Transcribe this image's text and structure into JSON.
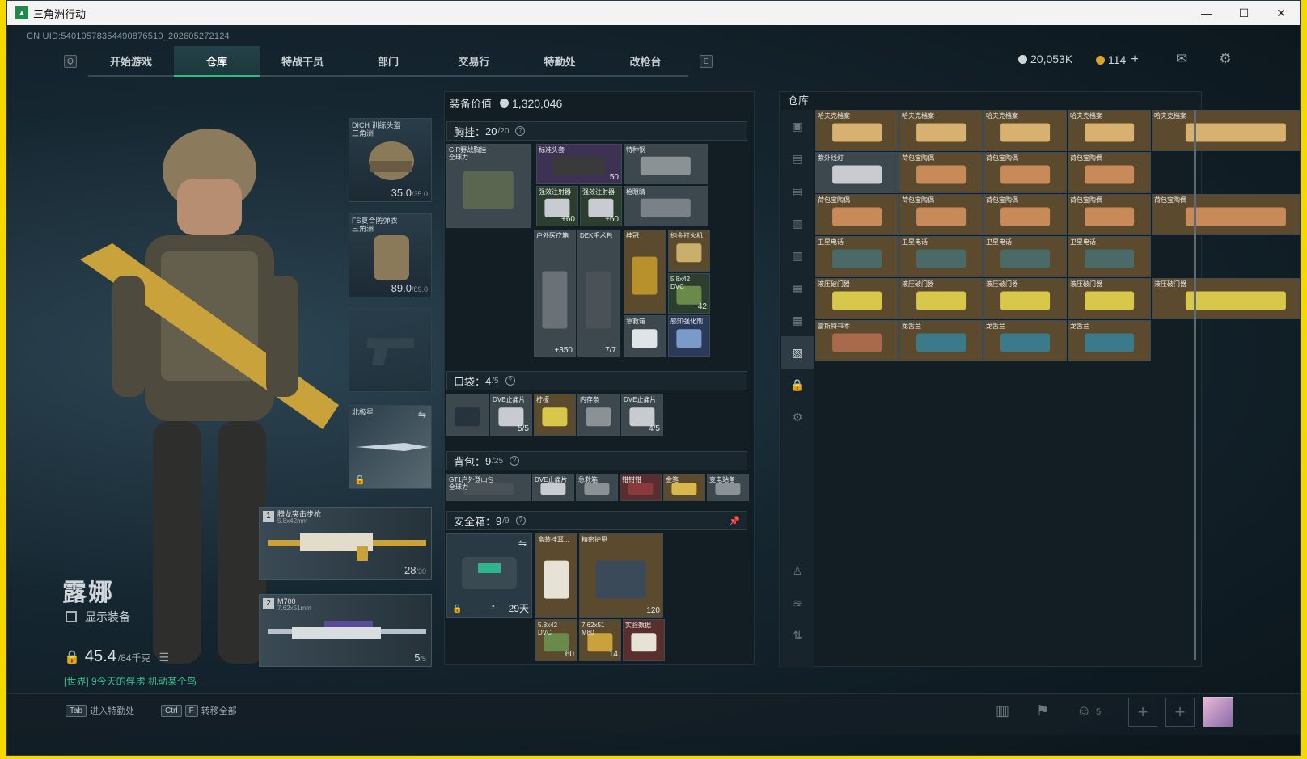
{
  "window": {
    "title": "三角洲行动"
  },
  "header": {
    "uid": "CN UID:5401057835449087651​0_202605272124",
    "tabs_left_key": "Q",
    "tabs_right_key": "E",
    "tabs": [
      "开始游戏",
      "仓库",
      "特战干员",
      "部门",
      "交易行",
      "特勤处",
      "改枪台"
    ],
    "active_tab": "仓库",
    "coins": "20,053K",
    "tokens": "114",
    "token_plus": "+"
  },
  "character": {
    "name": "露娜",
    "show_equipment": "显示装备",
    "weight": "45.4",
    "weight_max": "/84千克",
    "chat": "[世界] 9今天的俘虏 机动某个鸟"
  },
  "equip": {
    "helmet": {
      "label1": "DICH 训练头盔",
      "label2": "三角洲",
      "dur": "35.0",
      "max": "/35.0"
    },
    "armor": {
      "label1": "FS复合防弹衣",
      "label2": "三角洲",
      "dur": "89.0",
      "max": "/89.0"
    },
    "melee": {
      "label": "北极星"
    },
    "weapon1": {
      "num": "1",
      "name": "腾龙突击步枪",
      "sub": "5.8x42mm",
      "ammo": "28",
      "max": "/30"
    },
    "weapon2": {
      "num": "2",
      "name": "M700",
      "sub": "7.62x51mm",
      "ammo": "5",
      "max": "/5"
    }
  },
  "loadout": {
    "value_label": "装备价值",
    "value": "1,320,046",
    "chest": {
      "title": "胸挂：",
      "cur": "20",
      "max": "/20"
    },
    "chest_items": [
      {
        "n": "GIR野战胸挂\n全球力",
        "c": ""
      },
      {
        "n": "标准头套",
        "c": "50"
      },
      {
        "n": "特种钢",
        "c": ""
      },
      {
        "n": "强效注射器",
        "c": "+60"
      },
      {
        "n": "强效注射器",
        "c": "+60"
      },
      {
        "n": "枪眼睛",
        "c": ""
      },
      {
        "n": "户外医疗箱",
        "c": "+350"
      },
      {
        "n": "DEK手术包",
        "c": "7/7"
      },
      {
        "n": "桂冠",
        "c": ""
      },
      {
        "n": "纯金打火机",
        "c": ""
      },
      {
        "n": "5.8x42\nDVC",
        "c": "42"
      },
      {
        "n": "急救箱",
        "c": ""
      },
      {
        "n": "感知强化剂",
        "c": ""
      }
    ],
    "pocket": {
      "title": "口袋：",
      "cur": "4",
      "max": "/5"
    },
    "pocket_items": [
      {
        "n": "",
        "c": ""
      },
      {
        "n": "DVE止痛片",
        "c": "5/5"
      },
      {
        "n": "柠檬",
        "c": ""
      },
      {
        "n": "内存条",
        "c": ""
      },
      {
        "n": "DVE止痛片",
        "c": "4/5"
      }
    ],
    "backpack": {
      "title": "背包：",
      "cur": "9",
      "max": "/25"
    },
    "backpack_items": [
      {
        "n": "GT1户外登山包\n全球力",
        "c": ""
      },
      {
        "n": "DVE止痛片",
        "c": ""
      },
      {
        "n": "急救箱",
        "c": ""
      },
      {
        "n": "钳钳钳",
        "c": ""
      },
      {
        "n": "金笔",
        "c": ""
      },
      {
        "n": "变电站备",
        "c": ""
      }
    ],
    "safe": {
      "title": "安全箱：",
      "cur": "9",
      "max": "/9",
      "days": "29天"
    },
    "safe_items": [
      {
        "n": "盒装挂耳...",
        "c": ""
      },
      {
        "n": "精密护甲",
        "c": "120"
      },
      {
        "n": "5.8x42\nDVC",
        "c": "60"
      },
      {
        "n": "7.62x51\nM80",
        "c": "14"
      },
      {
        "n": "实验数据",
        "c": ""
      }
    ]
  },
  "stash": {
    "title": "仓库",
    "items": [
      {
        "n": "哈夫克档案"
      },
      {
        "n": "哈夫克档案"
      },
      {
        "n": "哈夫克档案"
      },
      {
        "n": "哈夫克档案"
      },
      {
        "n": "哈夫克档案"
      },
      {
        "n": "紫外线灯"
      },
      {
        "n": "荷包宝陶偶"
      },
      {
        "n": "荷包宝陶偶"
      },
      {
        "n": "荷包宝陶偶"
      },
      {
        "n": "荷包宝陶偶"
      },
      {
        "n": "荷包宝陶偶"
      },
      {
        "n": "荷包宝陶偶"
      },
      {
        "n": "荷包宝陶偶"
      },
      {
        "n": "荷包宝陶偶"
      },
      {
        "n": "卫星电话"
      },
      {
        "n": "卫星电话"
      },
      {
        "n": "卫星电话"
      },
      {
        "n": "卫星电话"
      },
      {
        "n": "液压破门器"
      },
      {
        "n": "液压破门器"
      },
      {
        "n": "液压破门器"
      },
      {
        "n": "液压破门器"
      },
      {
        "n": "液压破门器"
      },
      {
        "n": "雷斯特书本"
      },
      {
        "n": "龙舌兰"
      },
      {
        "n": "龙舌兰"
      },
      {
        "n": "龙舌兰"
      }
    ]
  },
  "bottom": {
    "hint1_key": "Tab",
    "hint1": "进入特勤处",
    "hint2_key1": "Ctrl",
    "hint2_key2": "F",
    "hint2": "转移全部",
    "friends": "5",
    "plus": "+"
  }
}
